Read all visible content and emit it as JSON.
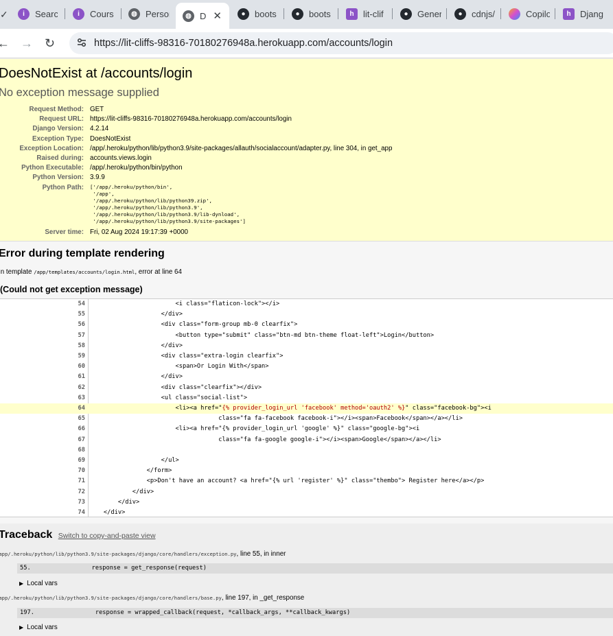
{
  "browser": {
    "tabs": [
      {
        "label": "Search",
        "icon": "purple-circle-icon"
      },
      {
        "label": "Course",
        "icon": "purple-circle-icon"
      },
      {
        "label": "Person",
        "icon": "globe-icon"
      },
      {
        "label": "D",
        "icon": "globe-icon"
      },
      {
        "label": "boots",
        "icon": "github-icon"
      },
      {
        "label": "boots",
        "icon": "github-icon"
      },
      {
        "label": "lit-clif",
        "icon": "django-icon"
      },
      {
        "label": "Gener",
        "icon": "github-icon"
      },
      {
        "label": "cdnjs/",
        "icon": "github-icon"
      },
      {
        "label": "Copilo",
        "icon": "copilot-icon"
      },
      {
        "label": "Djang",
        "icon": "django-icon"
      }
    ],
    "url": "https://lit-cliffs-98316-70180276948a.herokuapp.com/accounts/login"
  },
  "summary": {
    "title": "DoesNotExist at /accounts/login",
    "message": "No exception message supplied",
    "meta": [
      {
        "key": "Request Method:",
        "value": "GET"
      },
      {
        "key": "Request URL:",
        "value": "https://lit-cliffs-98316-70180276948a.herokuapp.com/accounts/login"
      },
      {
        "key": "Django Version:",
        "value": "4.2.14"
      },
      {
        "key": "Exception Type:",
        "value": "DoesNotExist"
      },
      {
        "key": "Exception Location:",
        "value": "/app/.heroku/python/lib/python3.9/site-packages/allauth/socialaccount/adapter.py, line 304, in get_app"
      },
      {
        "key": "Raised during:",
        "value": "accounts.views.login"
      },
      {
        "key": "Python Executable:",
        "value": "/app/.heroku/python/bin/python"
      },
      {
        "key": "Python Version:",
        "value": "3.9.9"
      },
      {
        "key": "Python Path:",
        "value": "['/app/.heroku/python/bin',\n '/app',\n '/app/.heroku/python/lib/python39.zip',\n '/app/.heroku/python/lib/python3.9',\n '/app/.heroku/python/lib/python3.9/lib-dynload',\n '/app/.heroku/python/lib/python3.9/site-packages']"
      },
      {
        "key": "Server time:",
        "value": "Fri, 02 Aug 2024 19:17:39 +0000"
      }
    ]
  },
  "template": {
    "heading": "Error during template rendering",
    "info_prefix": "In template",
    "info_path": "/app/templates/accounts/login.html",
    "info_suffix": ", error at line 64",
    "subheading": "(Could not get exception message)",
    "source_lines": [
      {
        "num": "54",
        "code": "                        <i class=\"flaticon-lock\"></i>"
      },
      {
        "num": "55",
        "code": "                    </div>"
      },
      {
        "num": "56",
        "code": "                    <div class=\"form-group mb-0 clearfix\">"
      },
      {
        "num": "57",
        "code": "                        <button type=\"submit\" class=\"btn-md btn-theme float-left\">Login</button>"
      },
      {
        "num": "58",
        "code": "                    </div>"
      },
      {
        "num": "59",
        "code": "                    <div class=\"extra-login clearfix\">"
      },
      {
        "num": "60",
        "code": "                        <span>Or Login With</span>"
      },
      {
        "num": "61",
        "code": "                    </div>"
      },
      {
        "num": "62",
        "code": "                    <div class=\"clearfix\"></div>"
      },
      {
        "num": "63",
        "code": "                    <ul class=\"social-list\">"
      },
      {
        "num": "64",
        "code_before": "                        <li><a href=\"",
        "code_error": "{% provider_login_url 'facebook' method='oauth2' %}",
        "code_after": "\" class=\"facebook-bg\"><i",
        "highlight": true
      },
      {
        "num": "65",
        "code": "                                    class=\"fa fa-facebook facebook-i\"></i><span>Facebook</span></a></li>"
      },
      {
        "num": "66",
        "code": "                        <li><a href=\"{% provider_login_url 'google' %}\" class=\"google-bg\"><i"
      },
      {
        "num": "67",
        "code": "                                    class=\"fa fa-google google-i\"></i><span>Google</span></a></li>"
      },
      {
        "num": "68",
        "code": ""
      },
      {
        "num": "69",
        "code": "                    </ul>"
      },
      {
        "num": "70",
        "code": "                </form>"
      },
      {
        "num": "71",
        "code": "                <p>Don't have an account? <a href=\"{% url 'register' %}\" class=\"thembo\"> Register here</a></p>"
      },
      {
        "num": "72",
        "code": "            </div>"
      },
      {
        "num": "73",
        "code": "        </div>"
      },
      {
        "num": "74",
        "code": "    </div>"
      }
    ]
  },
  "traceback": {
    "heading": "Traceback",
    "switch_link": "Switch to copy-and-paste view",
    "frames": [
      {
        "file": "/app/.heroku/python/lib/python3.9/site-packages/django/core/handlers/exception.py",
        "suffix": ", line 55, in inner",
        "line": "55.                 response = get_response(request)",
        "local_vars": "Local vars"
      },
      {
        "file": "/app/.heroku/python/lib/python3.9/site-packages/django/core/handlers/base.py",
        "suffix": ", line 197, in _get_response",
        "line": "197.                 response = wrapped_callback(request, *callback_args, **callback_kwargs)",
        "local_vars": "Local vars"
      }
    ]
  },
  "colors": {
    "summary_bg": "#ffffcc",
    "highlight_bg": "#ffffcc",
    "error_text": "#b30000",
    "tab_bar": "#dfe3e8"
  }
}
